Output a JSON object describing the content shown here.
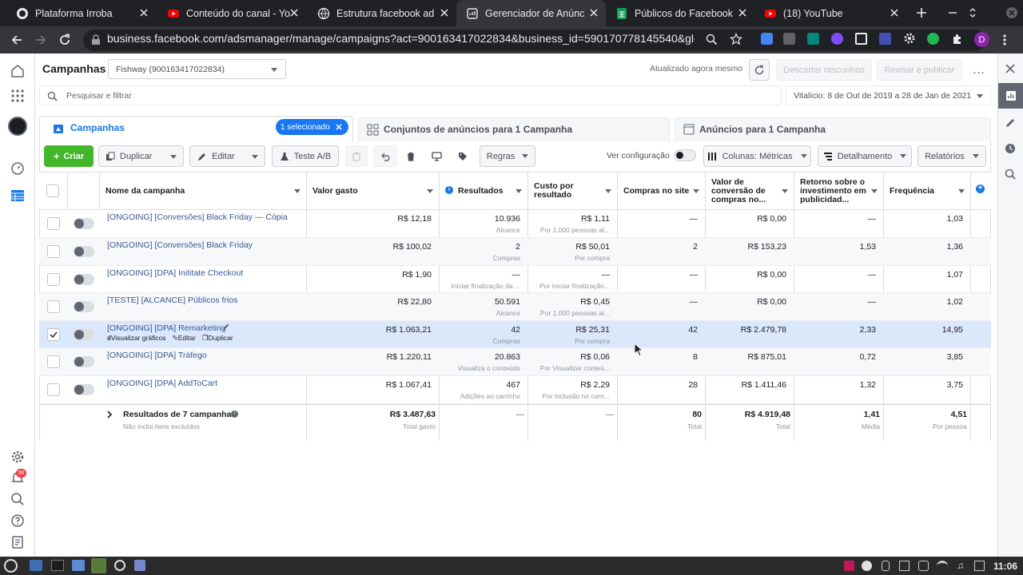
{
  "browser": {
    "tabs": [
      {
        "title": "Plataforma Irroba",
        "icon": "github-icon"
      },
      {
        "title": "Conteúdo do canal - Yo",
        "icon": "youtube-icon"
      },
      {
        "title": "Estrutura facebook ad",
        "icon": "globe-icon"
      },
      {
        "title": "Gerenciador de Anúnc",
        "icon": "ads-manager-icon"
      },
      {
        "title": "Públicos do Facebook",
        "icon": "sheets-icon"
      },
      {
        "title": "(18) YouTube",
        "icon": "youtube-icon"
      }
    ],
    "url": "business.facebook.com/adsmanager/manage/campaigns?act=900163417022834&business_id=590170778145540&global_...",
    "profile_initial": "D"
  },
  "header": {
    "title": "Campanhas",
    "account": "Fishway (900163417022834)",
    "updated": "Atualizado agora mesmo",
    "discard": "Descartar rascunhos",
    "review": "Revisar e publicar",
    "search_placeholder": "Pesquisar e filtrar",
    "date_range": "Vitalício: 8 de Out de 2019 a 28 de Jan de 2021"
  },
  "levels": {
    "campaigns": "Campanhas",
    "selected": "1 selecionado",
    "adsets": "Conjuntos de anúncios para 1 Campanha",
    "ads": "Anúncios para 1 Campanha"
  },
  "toolbar": {
    "create": "Criar",
    "duplicate": "Duplicar",
    "edit": "Editar",
    "ab_test": "Teste A/B",
    "rules": "Regras",
    "view_config": "Ver configuração",
    "columns": "Colunas: Métricas",
    "breakdown": "Detalhamento",
    "reports": "Relatórios"
  },
  "columns": [
    "Nome da campanha",
    "Valor gasto",
    "Resultados",
    "Custo por resultado",
    "Compras no site",
    "Valor de conversão de compras no...",
    "Retorno sobre o investimento em publicidad...",
    "Frequência"
  ],
  "rows": [
    {
      "name": "[ONGOING] [Conversões] Black Friday — Cópia",
      "spend": "R$ 12,18",
      "results": "10.936",
      "results_sub": "Alcance",
      "cpr": "R$ 1,11",
      "cpr_sub": "Por 1.000 pessoas al...",
      "purchases": "—",
      "conv_value": "R$ 0,00",
      "roas": "—",
      "freq": "1,03"
    },
    {
      "name": "[ONGOING] [Conversões] Black Friday",
      "spend": "R$ 100,02",
      "results": "2",
      "results_sub": "Compras",
      "cpr": "R$ 50,01",
      "cpr_sub": "Por compra",
      "purchases": "2",
      "conv_value": "R$ 153,23",
      "roas": "1,53",
      "freq": "1,36"
    },
    {
      "name": "[ONGOING] [DPA] Inititate Checkout",
      "spend": "R$ 1,90",
      "results": "—",
      "results_sub": "Iniciar finalização da ...",
      "cpr": "—",
      "cpr_sub": "Por Iniciar finalização...",
      "purchases": "—",
      "conv_value": "R$ 0,00",
      "roas": "—",
      "freq": "1,07"
    },
    {
      "name": "[TESTE] [ALCANCE] Públicos frios",
      "spend": "R$ 22,80",
      "results": "50.591",
      "results_sub": "Alcance",
      "cpr": "R$ 0,45",
      "cpr_sub": "Por 1.000 pessoas al...",
      "purchases": "—",
      "conv_value": "R$ 0,00",
      "roas": "—",
      "freq": "1,02"
    },
    {
      "name": "[ONGOING] [DPA] Remarketing",
      "spend": "R$ 1.063,21",
      "results": "42",
      "results_sub": "Compras",
      "cpr": "R$ 25,31",
      "cpr_sub": "Por compra",
      "purchases": "42",
      "conv_value": "R$ 2.479,78",
      "roas": "2,33",
      "freq": "14,95"
    },
    {
      "name": "[ONGOING] [DPA] Tráfego",
      "spend": "R$ 1.220,11",
      "results": "20.863",
      "results_sub": "Visualiza o conteúdo",
      "cpr": "R$ 0,06",
      "cpr_sub": "Por Visualizar conteú...",
      "purchases": "8",
      "conv_value": "R$ 875,01",
      "roas": "0,72",
      "freq": "3,85"
    },
    {
      "name": "[ONGOING] [DPA] AddToCart",
      "spend": "R$ 1.067,41",
      "results": "467",
      "results_sub": "Adições ao carrinho",
      "cpr": "R$ 2,29",
      "cpr_sub": "Por inclusão no carri...",
      "purchases": "28",
      "conv_value": "R$ 1.411,46",
      "roas": "1,32",
      "freq": "3,75"
    }
  ],
  "row_actions": {
    "charts": "Visualizar gráficos",
    "edit": "Editar",
    "duplicate": "Duplicar"
  },
  "totals": {
    "label": "Resultados de 7 campanhas",
    "note": "Não inclui itens excluídos",
    "spend": "R$ 3.487,63",
    "spend_sub": "Total gasto",
    "results": "—",
    "cpr": "—",
    "purchases": "80",
    "purchases_sub": "Total",
    "conv_value": "R$ 4.919,48",
    "conv_sub": "Total",
    "roas": "1,41",
    "roas_sub": "Média",
    "freq": "4,51",
    "freq_sub": "Por pessoa"
  },
  "notifications": "98",
  "clock": "11:06",
  "colors": {
    "primary": "#1877f2",
    "create": "#42b72a",
    "selected_row": "#dbe7fb",
    "link": "#385898"
  }
}
